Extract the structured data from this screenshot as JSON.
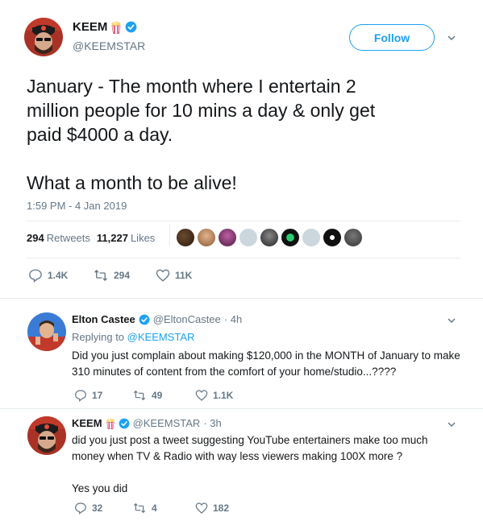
{
  "tweet": {
    "author_name": "KEEM",
    "author_handle": "@KEEMSTAR",
    "follow_label": "Follow",
    "text": "January - The month where I entertain 2\nmillion people for 10 mins a day & only get\npaid $4000 a day.\n\nWhat a month to be alive!",
    "timestamp": "1:59 PM - 4 Jan 2019",
    "retweets_count": "294",
    "retweets_label": "Retweets",
    "likes_count": "11,227",
    "likes_label": "Likes",
    "actions": {
      "replies": "1.4K",
      "retweets": "294",
      "likes": "11K"
    }
  },
  "replies": [
    {
      "author_name": "Elton Castee",
      "author_handle": "@EltonCastee",
      "time": "· 4h",
      "replying_prefix": "Replying to",
      "replying_handle": "@KEEMSTAR",
      "text": "Did you just complain about making $120,000 in the MONTH of January to make\n310 minutes of content from the comfort of your home/studio...????",
      "actions": {
        "replies": "17",
        "retweets": "49",
        "likes": "1.1K"
      }
    },
    {
      "author_name": "KEEM",
      "author_handle": "@KEEMSTAR",
      "time": "· 3h",
      "text": "did you just post a tweet suggesting YouTube entertainers make too much\nmoney when TV & Radio with way less viewers making 100X more ?\n\nYes you did",
      "actions": {
        "replies": "32",
        "retweets": "4",
        "likes": "182"
      }
    }
  ],
  "colors": {
    "accent": "#1da1f2",
    "muted": "#657786",
    "text": "#14171a",
    "border": "#e6ecf0"
  },
  "icons": [
    "verified-badge-icon",
    "popcorn-icon",
    "chevron-down-icon",
    "reply-icon",
    "retweet-icon",
    "like-icon"
  ]
}
